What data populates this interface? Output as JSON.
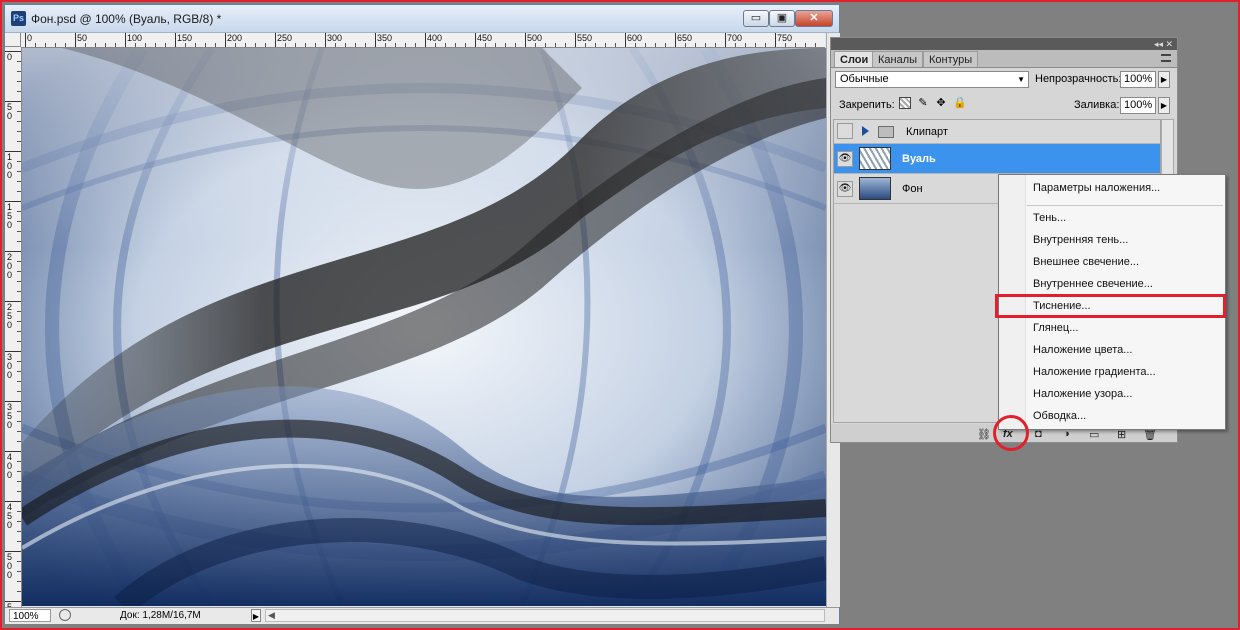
{
  "window": {
    "app_icon_text": "Ps",
    "title": "Фон.psd @ 100% (Вуаль, RGB/8) *",
    "controls": {
      "minimize": "▭",
      "maximize": "▣",
      "close": "✕"
    }
  },
  "ruler": {
    "h_labels": [
      "0",
      "50",
      "100",
      "150",
      "200",
      "250",
      "300",
      "350",
      "400",
      "450",
      "500",
      "550",
      "600",
      "650",
      "700",
      "750"
    ],
    "v_labels": [
      "0",
      "50",
      "100",
      "150",
      "200",
      "250",
      "300",
      "350",
      "400",
      "450",
      "500",
      "550"
    ]
  },
  "status": {
    "zoom": "100%",
    "doc": "Док: 1,28M/16,7M",
    "arrow": "▶",
    "scroll_left": "◀"
  },
  "panel": {
    "collapse_glyph": "◂◂",
    "close_glyph": "✕",
    "tabs": [
      "Слои",
      "Каналы",
      "Контуры"
    ],
    "blend_mode": "Обычные",
    "blend_arrow": "▼",
    "opacity_label": "Непрозрачность:",
    "opacity_value": "100%",
    "stepper_glyph": "▶",
    "lock_label": "Закрепить:",
    "lock_icons": {
      "paint": "✎",
      "move": "✥",
      "all": "🔒"
    },
    "fill_label": "Заливка:",
    "fill_value": "100%",
    "eye_glyph": "👁",
    "layers": [
      {
        "name": "Клипарт",
        "type": "group",
        "visible": false
      },
      {
        "name": "Вуаль",
        "type": "layer",
        "selected": true,
        "visible": true
      },
      {
        "name": "Фон",
        "type": "layer",
        "visible": true
      }
    ],
    "bottom_icons": {
      "link": "⛓",
      "fx": "fx",
      "mask": "◘",
      "adjust": "◑",
      "group": "▭",
      "new": "⊞",
      "trash": "🗑"
    }
  },
  "context_menu": {
    "items": [
      "Параметры наложения...",
      "Тень...",
      "Внутренняя тень...",
      "Внешнее свечение...",
      "Внутреннее свечение...",
      "Тиснение...",
      "Глянец...",
      "Наложение цвета...",
      "Наложение градиента...",
      "Наложение узора...",
      "Обводка..."
    ],
    "highlighted": "Тиснение..."
  },
  "colors": {
    "highlight_red": "#e0202c",
    "selection_blue": "#3b93ee",
    "panel_gray": "#d6d6d6",
    "workspace_gray": "#808080"
  }
}
